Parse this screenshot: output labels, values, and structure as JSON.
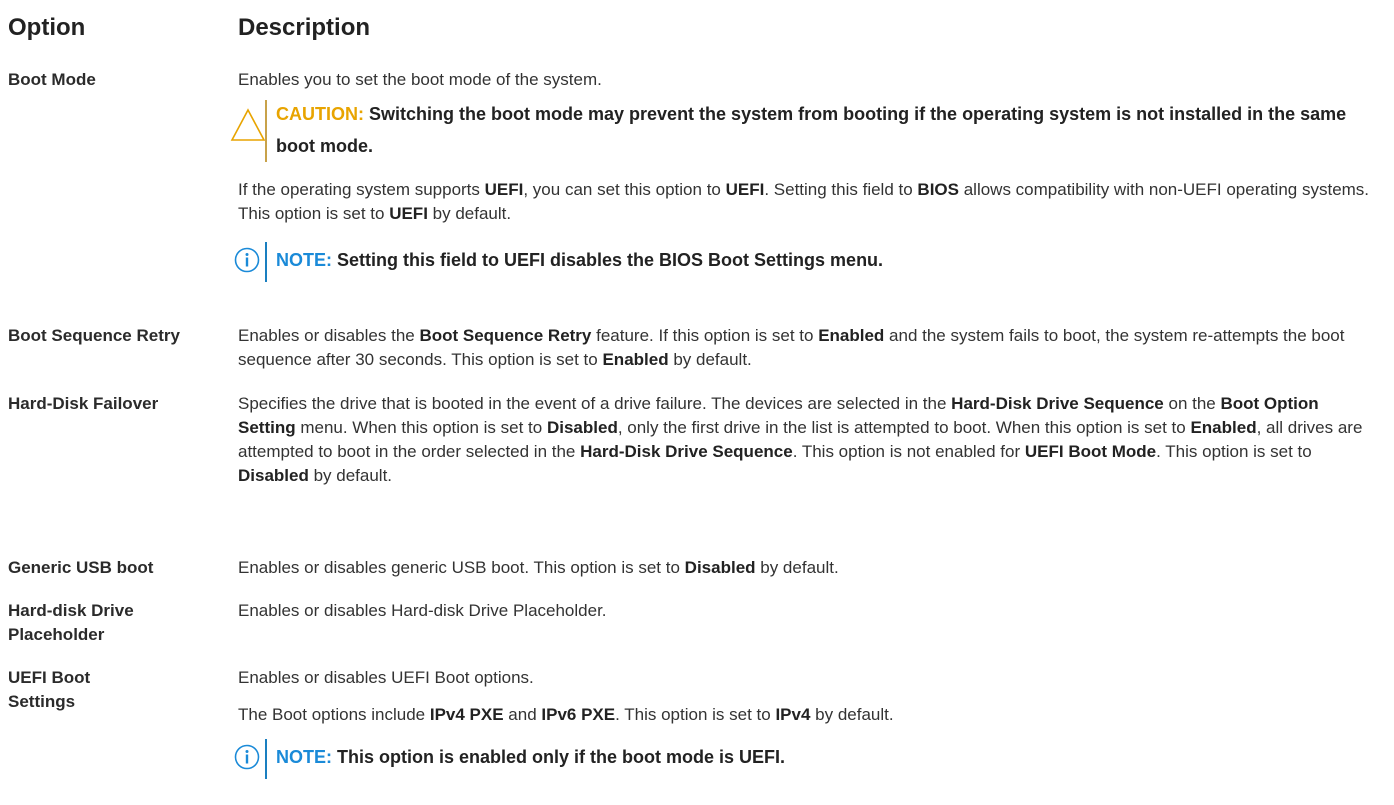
{
  "header": {
    "option": "Option",
    "description": "Description"
  },
  "rows": {
    "boot_mode": {
      "option": "Boot Mode",
      "line1": "Enables you to set the boot mode of the system.",
      "caution_label": "CAUTION:",
      "caution_text": "Switching the boot mode may prevent the system from booting if the operating system is not installed in the same boot mode.",
      "p1": "If the operating system supports ",
      "p2": "UEFI",
      "p3": ", you can set this option to ",
      "p4": "UEFI",
      "p5": ". Setting this field to ",
      "p6": "BIOS",
      "p7": " allows compatibility with non-UEFI operating systems. This option is set to ",
      "p8": "UEFI",
      "p9": " by default.",
      "note_label": "NOTE:",
      "note_text": "Setting this field to UEFI disables the BIOS Boot Settings menu."
    },
    "boot_seq_retry": {
      "option": "Boot Sequence Retry",
      "p1": "Enables or disables the ",
      "p2": "Boot Sequence Retry",
      "p3": " feature. If this option is set to ",
      "p4": "Enabled",
      "p5": " and the system fails to boot, the system re-attempts the boot sequence after 30 seconds. This option is set to ",
      "p6": "Enabled",
      "p7": " by default."
    },
    "hdd_failover": {
      "option": "Hard-Disk Failover",
      "p1": "Specifies the drive that is booted in the event of a drive failure. The devices are selected in the ",
      "p2": "Hard-Disk Drive Sequence",
      "p3": " on the ",
      "p4": "Boot Option Setting",
      "p5": " menu. When this option is set to ",
      "p6": "Disabled",
      "p7": ", only the first drive in the list is attempted to boot. When this option is set to ",
      "p8": "Enabled",
      "p9": ", all drives are attempted to boot in the order selected in the ",
      "p10": "Hard-Disk Drive Sequence",
      "p11": ". This option is not enabled for ",
      "p12": "UEFI Boot Mode",
      "p13": ". This option is set to ",
      "p14": "Disabled",
      "p15": " by default."
    },
    "generic_usb": {
      "option": "Generic USB boot",
      "p1": "Enables or disables generic USB boot. This option is set to ",
      "p2": "Disabled",
      "p3": " by default."
    },
    "hdd_placeholder": {
      "option": "Hard-disk Drive Placeholder",
      "p1": "Enables or disables Hard-disk Drive Placeholder."
    },
    "uefi_boot": {
      "option": "UEFI Boot Settings",
      "line1": "Enables or disables UEFI Boot options.",
      "p1": "The Boot options include ",
      "p2": "IPv4 PXE",
      "p3": " and ",
      "p4": "IPv6 PXE",
      "p5": ". This option is set to ",
      "p6": "IPv4",
      "p7": " by default.",
      "note_label": "NOTE:",
      "note_text": "This option is enabled only if the boot mode is UEFI."
    }
  },
  "colors": {
    "caution": "#e8a400",
    "note": "#1a8ad8"
  }
}
